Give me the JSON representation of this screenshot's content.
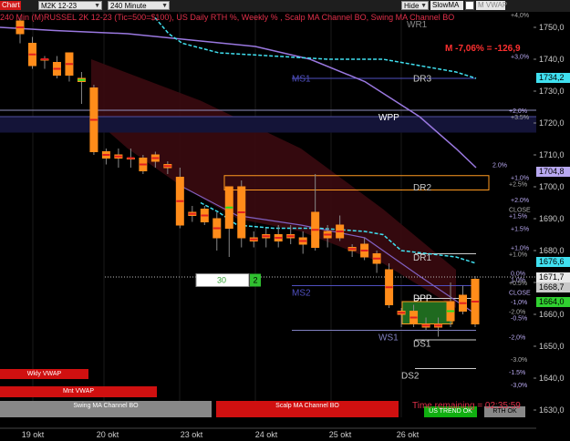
{
  "toolbar": {
    "chart_tab": "Chart",
    "instrument": "M2K 12-23",
    "interval": "240 Minute",
    "hide_label": "Hide",
    "indicator_select": "SlowMA",
    "vwap_label": "M VWAP"
  },
  "indicator_title": "240 Min (M)RUSSEL 2K 12-23 (Tic=500=$100), US Daily RTH %, Weekly % , Scalp MA Channel BO, Swing MA Channel BO",
  "metric": "M -7,06% = -126,9",
  "price_axis": [
    "1750,0",
    "1740,0",
    "1730,0",
    "1720,0",
    "1710,0",
    "1700,0",
    "1690,0",
    "1680,0",
    "1670,0",
    "1660,0",
    "1650,0",
    "1640,0",
    "1630,0"
  ],
  "time_axis": [
    "19 okt",
    "20 okt",
    "23 okt",
    "24 okt",
    "25 okt",
    "26 okt"
  ],
  "price_tags": [
    {
      "value": "1734,2",
      "bg": "#40e0f0"
    },
    {
      "value": "1704,8",
      "bg": "#b8a8f0"
    },
    {
      "value": "1676,6",
      "bg": "#40e0f0"
    },
    {
      "value": "1671,7",
      "bg": "#e8e8e8"
    },
    {
      "value": "1668,7",
      "bg": "#c8c8c8"
    },
    {
      "value": "1664,0",
      "bg": "#30d030"
    }
  ],
  "levels": {
    "wr1": "WR1",
    "dr3": "DR3",
    "ms1": "MS1",
    "wpp": "WPP",
    "dr2": "DR2",
    "dr1": "DR1",
    "ms2": "MS2",
    "dpp": "DPP",
    "ws1": "WS1",
    "ds1": "DS1",
    "ds2": "DS2"
  },
  "pct_labels": [
    "+4,0%",
    "+3,0%",
    "+2,0%",
    "+3.5%",
    "2.0%",
    "+1,0%",
    "+2.5%",
    "+1.5%",
    "+2.0%",
    "CLOSE",
    "+1.5%",
    "+1,0%",
    "+1.0%",
    "1.0%",
    "0,0%",
    "+0.5%",
    "CLOSE",
    "-1,0%",
    "-2.0%",
    "-0.5%",
    "-2,0%",
    "-3.0%",
    "-1.5%",
    "-3,0%"
  ],
  "scalp_box": {
    "value": "30",
    "count": "2"
  },
  "buttons": {
    "wkly_vwap": "Wkly VWAP",
    "mnt_vwap": "Mnt VWAP",
    "swing": "Swing MA Channel BO",
    "scalp": "Scalp MA Channel BO",
    "ustren": "US TREND OK",
    "rthok": "RTH OK"
  },
  "time_remaining": "Time remaining = 02:35:59",
  "colors": {
    "up": "#ff8c1a",
    "down": "#ff8c1a",
    "cyan": "#40e0f0",
    "purple": "#9a78e0",
    "red": "#e0304a"
  },
  "chart_data": {
    "type": "candlestick",
    "x_ticks": [
      "19 okt",
      "20 okt",
      "23 okt",
      "24 okt",
      "25 okt",
      "26 okt"
    ],
    "y_ticks": [
      1750,
      1740,
      1730,
      1720,
      1710,
      1700,
      1690,
      1680,
      1670,
      1660,
      1650,
      1640,
      1630
    ],
    "ylim": [
      1627,
      1755
    ],
    "candles": [
      {
        "o": 1752,
        "h": 1753,
        "l": 1745,
        "c": 1748
      },
      {
        "o": 1745,
        "h": 1747,
        "l": 1737,
        "c": 1738
      },
      {
        "o": 1740,
        "h": 1741,
        "l": 1737,
        "c": 1740
      },
      {
        "o": 1739,
        "h": 1741,
        "l": 1734,
        "c": 1735
      },
      {
        "o": 1742,
        "h": 1742,
        "l": 1733,
        "c": 1735
      },
      {
        "o": 1733,
        "h": 1736,
        "l": 1726,
        "c": 1734
      },
      {
        "o": 1731,
        "h": 1732,
        "l": 1710,
        "c": 1711
      },
      {
        "o": 1711,
        "h": 1712,
        "l": 1707,
        "c": 1709
      },
      {
        "o": 1710,
        "h": 1712,
        "l": 1706,
        "c": 1709
      },
      {
        "o": 1709,
        "h": 1712,
        "l": 1706,
        "c": 1709
      },
      {
        "o": 1709,
        "h": 1710,
        "l": 1704,
        "c": 1705
      },
      {
        "o": 1708,
        "h": 1711,
        "l": 1706,
        "c": 1710
      },
      {
        "o": 1707,
        "h": 1708,
        "l": 1704,
        "c": 1706
      },
      {
        "o": 1703,
        "h": 1706,
        "l": 1687,
        "c": 1688
      },
      {
        "o": 1692,
        "h": 1694,
        "l": 1689,
        "c": 1691
      },
      {
        "o": 1693,
        "h": 1694,
        "l": 1688,
        "c": 1689
      },
      {
        "o": 1690,
        "h": 1692,
        "l": 1680,
        "c": 1684
      },
      {
        "o": 1687,
        "h": 1700,
        "l": 1678,
        "c": 1700
      },
      {
        "o": 1700,
        "h": 1702,
        "l": 1681,
        "c": 1684
      },
      {
        "o": 1684,
        "h": 1686,
        "l": 1681,
        "c": 1683
      },
      {
        "o": 1685,
        "h": 1687,
        "l": 1681,
        "c": 1684
      },
      {
        "o": 1685,
        "h": 1688,
        "l": 1681,
        "c": 1683
      },
      {
        "o": 1684,
        "h": 1688,
        "l": 1682,
        "c": 1685
      },
      {
        "o": 1684,
        "h": 1686,
        "l": 1679,
        "c": 1682
      },
      {
        "o": 1692,
        "h": 1704,
        "l": 1680,
        "c": 1681
      },
      {
        "o": 1684,
        "h": 1688,
        "l": 1681,
        "c": 1686
      },
      {
        "o": 1688,
        "h": 1691,
        "l": 1683,
        "c": 1684
      },
      {
        "o": 1680,
        "h": 1682,
        "l": 1678,
        "c": 1681
      },
      {
        "o": 1682,
        "h": 1684,
        "l": 1677,
        "c": 1678
      },
      {
        "o": 1679,
        "h": 1680,
        "l": 1673,
        "c": 1676
      },
      {
        "o": 1674,
        "h": 1676,
        "l": 1662,
        "c": 1663
      },
      {
        "o": 1661,
        "h": 1662,
        "l": 1656,
        "c": 1660
      },
      {
        "o": 1661,
        "h": 1663,
        "l": 1656,
        "c": 1657
      },
      {
        "o": 1657,
        "h": 1659,
        "l": 1655,
        "c": 1656
      },
      {
        "o": 1656,
        "h": 1659,
        "l": 1653,
        "c": 1657
      },
      {
        "o": 1664,
        "h": 1670,
        "l": 1656,
        "c": 1658
      },
      {
        "o": 1666,
        "h": 1669,
        "l": 1660,
        "c": 1661
      },
      {
        "o": 1671,
        "h": 1672,
        "l": 1656,
        "c": 1657
      }
    ]
  }
}
